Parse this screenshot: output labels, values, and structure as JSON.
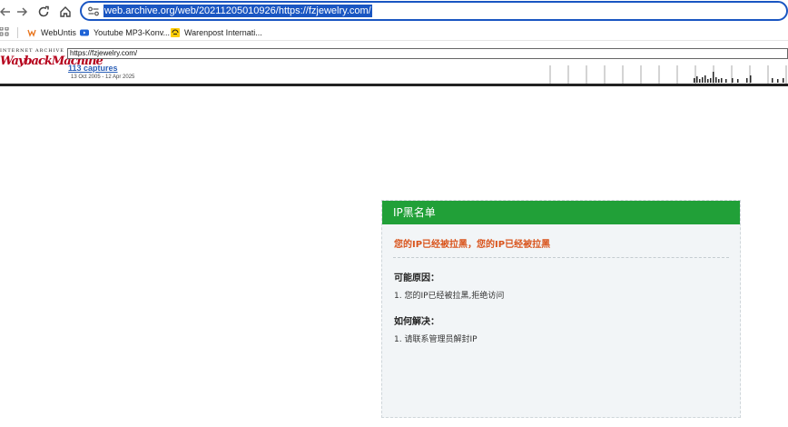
{
  "browser": {
    "address": "web.archive.org/web/20211205010926/https://fzjewelry.com/",
    "bookmarks": [
      {
        "label": "WebUntis",
        "icon": "webuntis-icon"
      },
      {
        "label": "Youtube MP3-Konv...",
        "icon": "youtube-icon"
      },
      {
        "label": "Warenpost Internati...",
        "icon": "deutsche-post-icon"
      }
    ]
  },
  "wayback": {
    "logo_top": "INTERNET ARCHIVE",
    "logo_main": "WaybackMachine",
    "url_value": "https://fzjewelry.com/",
    "captures": "113 captures",
    "date_range": "13 Oct 2005 - 12 Apr 2025"
  },
  "panel": {
    "header": "IP黑名单",
    "alert": "您的IP已经被拉黑，您的IP已经被拉黑",
    "reason_title": "可能原因：",
    "reason_item": "1. 您的IP已经被拉黑,拒绝访问",
    "solution_title": "如何解决：",
    "solution_item": "1. 请联系管理员解封IP"
  },
  "colors": {
    "accent": "#1a56c2",
    "panel_header": "#21a038",
    "alert_text": "#d9541c",
    "panel_bg": "#f2f5f7",
    "wayback_red": "#b5001b"
  }
}
